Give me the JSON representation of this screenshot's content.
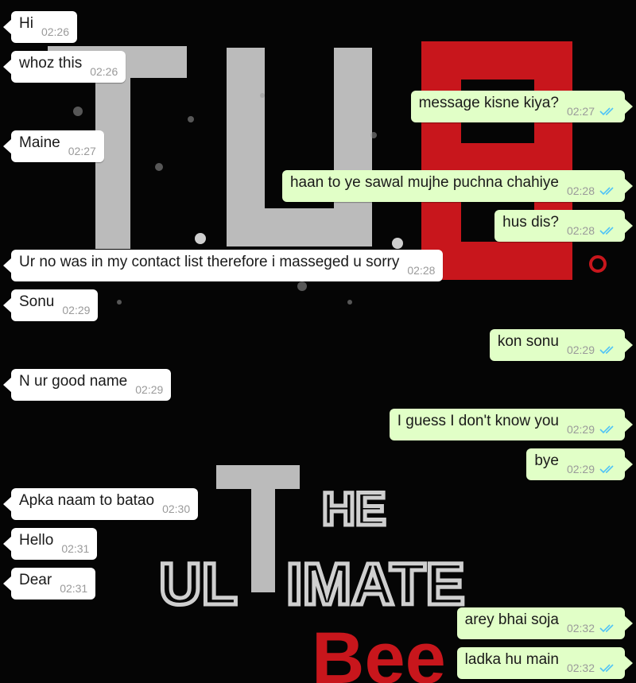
{
  "theme": {
    "incoming_bubble": "#ffffff",
    "outgoing_bubble": "#e1ffc7",
    "time_color": "#9a9a9a",
    "tick_color": "#4fc3f7",
    "wallpaper_bg": "#050505",
    "wallpaper_red": "#c8161c",
    "wallpaper_gray": "#cfcfcf"
  },
  "messages": [
    {
      "dir": "in",
      "text": "Hi",
      "time": "02:26"
    },
    {
      "dir": "in",
      "text": "whoz this",
      "time": "02:26"
    },
    {
      "dir": "out",
      "text": "message kisne kiya?",
      "time": "02:27",
      "ticks": "double-blue"
    },
    {
      "dir": "in",
      "text": "Maine",
      "time": "02:27"
    },
    {
      "dir": "out",
      "text": "haan to ye sawal mujhe puchna chahiye",
      "time": "02:28",
      "ticks": "double-blue"
    },
    {
      "dir": "out",
      "text": "hus dis?",
      "time": "02:28",
      "ticks": "double-blue"
    },
    {
      "dir": "in",
      "text": "Ur no was in my contact list therefore i masseged u sorry",
      "time": "02:28"
    },
    {
      "dir": "in",
      "text": "Sonu",
      "time": "02:29"
    },
    {
      "dir": "out",
      "text": "kon sonu",
      "time": "02:29",
      "ticks": "double-blue"
    },
    {
      "dir": "in",
      "text": "N ur good name",
      "time": "02:29"
    },
    {
      "dir": "out",
      "text": "I guess I don't know you",
      "time": "02:29",
      "ticks": "double-blue"
    },
    {
      "dir": "out",
      "text": "bye",
      "time": "02:29",
      "ticks": "double-blue"
    },
    {
      "dir": "in",
      "text": "Apka naam to batao",
      "time": "02:30"
    },
    {
      "dir": "in",
      "text": "Hello",
      "time": "02:31"
    },
    {
      "dir": "in",
      "text": "Dear",
      "time": "02:31"
    },
    {
      "dir": "out",
      "text": "arey bhai soja",
      "time": "02:32",
      "ticks": "double-blue"
    },
    {
      "dir": "out",
      "text": "ladka hu main",
      "time": "02:32",
      "ticks": "double-blue"
    }
  ]
}
